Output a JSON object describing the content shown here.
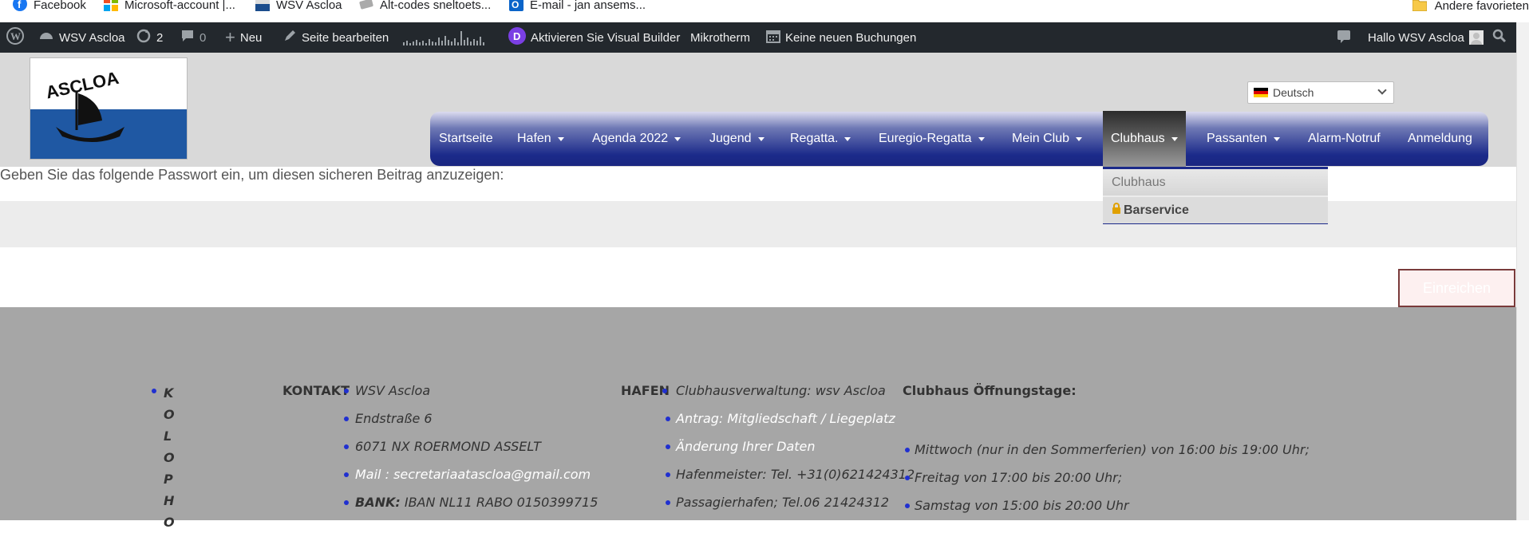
{
  "bookmarks": {
    "items": [
      {
        "label": "Facebook",
        "icon": "facebook-icon"
      },
      {
        "label": "Microsoft-account |...",
        "icon": "microsoft-icon"
      },
      {
        "label": "WSV Ascloa",
        "icon": "site-icon"
      },
      {
        "label": "Alt-codes sneltoets...",
        "icon": "keyboard-icon"
      },
      {
        "label": "E-mail - jan ansems...",
        "icon": "outlook-icon"
      }
    ],
    "other": "Andere favorieten"
  },
  "adminbar": {
    "site_name": "WSV Ascloa",
    "updates_count": "2",
    "comments_count": "0",
    "new_label": "Neu",
    "edit_label": "Seite bearbeiten",
    "visual_builder_label": "Aktivieren Sie Visual Builder",
    "mikrotherm_label": "Mikrotherm",
    "bookings_label": "Keine neuen Buchungen",
    "greeting": "Hallo WSV Ascloa"
  },
  "logo": {
    "text": "ASCLOA"
  },
  "language": {
    "selected": "Deutsch"
  },
  "nav": {
    "items": [
      {
        "label": "Startseite",
        "has_arrow": false
      },
      {
        "label": "Hafen",
        "has_arrow": true
      },
      {
        "label": "Agenda 2022",
        "has_arrow": true
      },
      {
        "label": "Jugend",
        "has_arrow": true
      },
      {
        "label": "Regatta.",
        "has_arrow": true
      },
      {
        "label": "Euregio-Regatta",
        "has_arrow": true
      },
      {
        "label": "Mein Club",
        "has_arrow": true
      },
      {
        "label": "Clubhaus",
        "has_arrow": true
      },
      {
        "label": "Passanten",
        "has_arrow": true
      },
      {
        "label": "Alarm-Notruf",
        "has_arrow": false
      },
      {
        "label": "Anmeldung",
        "has_arrow": false
      }
    ],
    "active": "Clubhaus"
  },
  "dropdown": {
    "items": [
      {
        "label": "Clubhaus"
      },
      {
        "label": "Barservice",
        "locked": true
      }
    ]
  },
  "content": {
    "prompt": "Geben Sie das folgende Passwort ein, um diesen sicheren Beitrag anzuzeigen:",
    "submit_label": "Einreichen"
  },
  "footer": {
    "vertical_letters": [
      "K",
      "O",
      "L",
      "O",
      "P",
      "H",
      "O"
    ],
    "kontakt": {
      "label": "KONTAKT",
      "lines": [
        "WSV Ascloa",
        "Endstraße 6",
        "6071 NX ROERMOND ASSELT"
      ],
      "mail_prefix": "Mail : ",
      "mail": "secretariaatascloa@gmail.com",
      "bank_prefix": "BANK:",
      "bank": " IBAN NL11 RABO 0150399715"
    },
    "hafen": {
      "label": "HAFEN",
      "lines": [
        {
          "text": "Clubhausverwaltung: wsv Ascloa",
          "link": false
        },
        {
          "text": "Antrag: Mitgliedschaft / Liegeplatz",
          "link": true
        },
        {
          "text": "Änderung Ihrer Daten",
          "link": true
        },
        {
          "text": "Hafenmeister: Tel. +31(0)621424312",
          "link": false
        },
        {
          "text": "Passagierhafen; Tel.06 21424312",
          "link": false
        }
      ]
    },
    "opening": {
      "title": "Clubhaus Öffnungstage:",
      "lines": [
        "Mittwoch (nur in den Sommerferien) von 16:00 bis 19:00 Uhr;",
        "Freitag von 17:00 bis 20:00 Uhr;",
        "Samstag von 15:00 bis 20:00 Uhr"
      ]
    }
  }
}
